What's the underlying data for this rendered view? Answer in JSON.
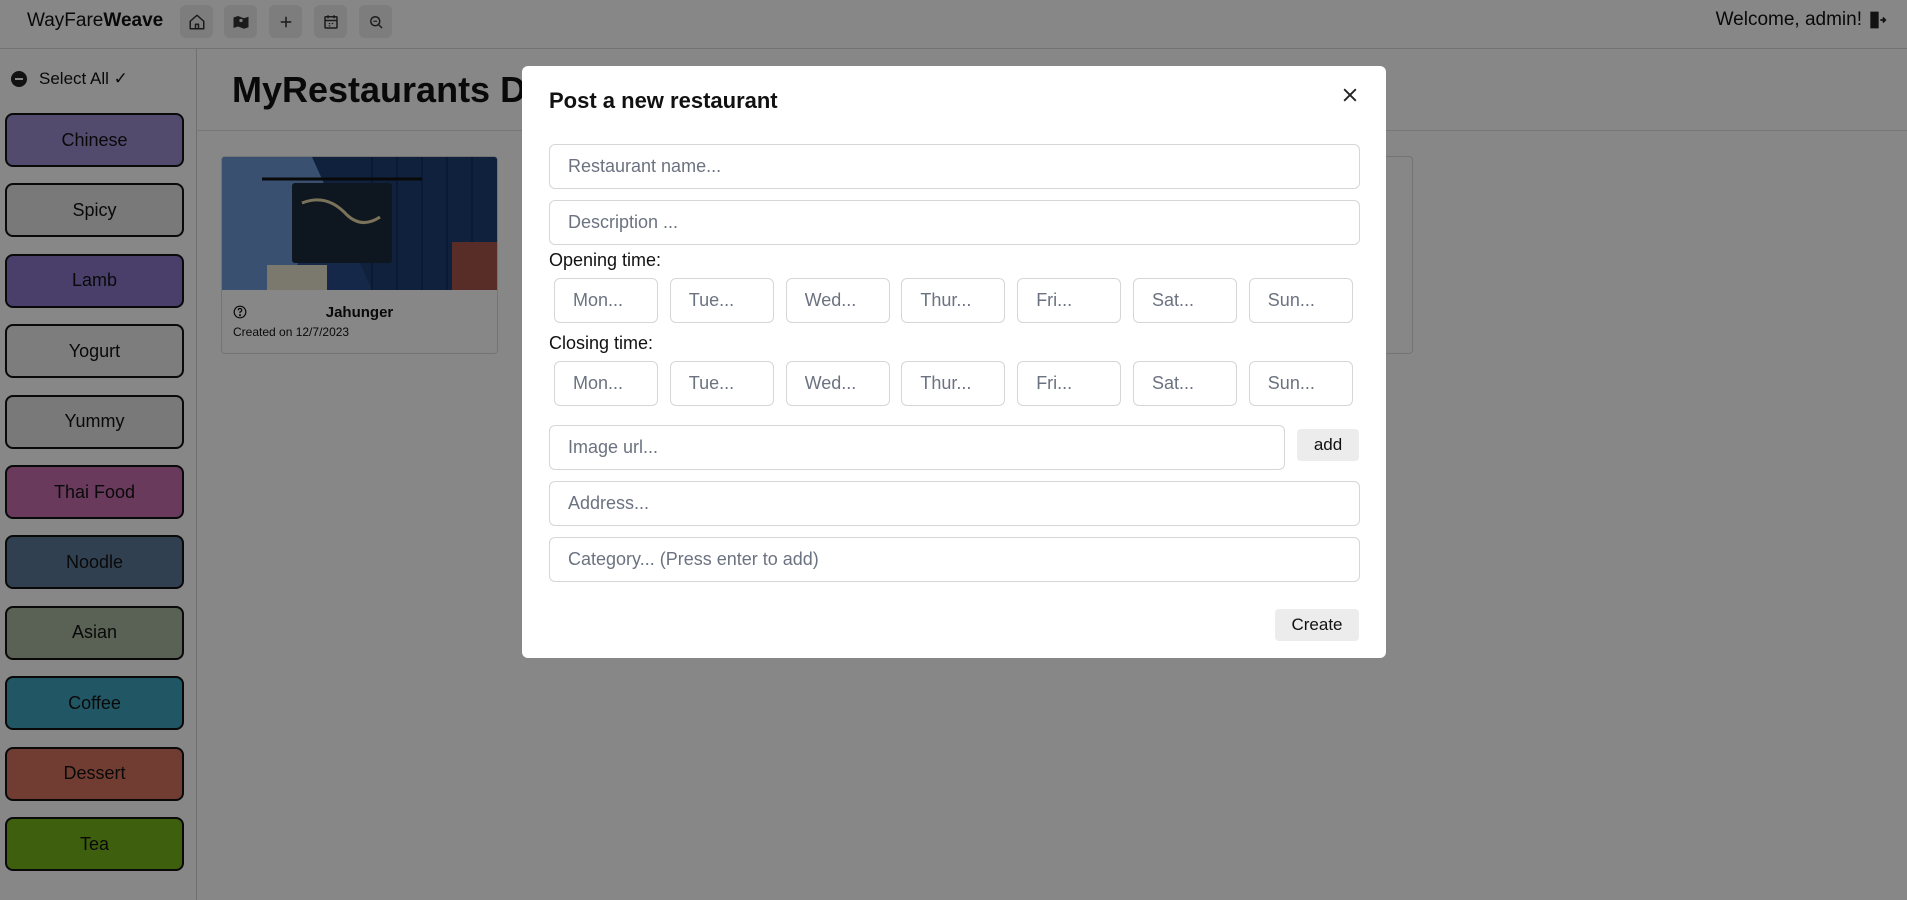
{
  "header": {
    "brand_plain": "WayFare",
    "brand_bold": "Weave",
    "nav": [
      {
        "icon": "home-icon"
      },
      {
        "icon": "map-icon"
      },
      {
        "icon": "plus-icon"
      },
      {
        "icon": "calendar-icon"
      },
      {
        "icon": "search-icon"
      }
    ],
    "welcome": "Welcome, admin!",
    "logout_icon": "logout-icon"
  },
  "sidebar": {
    "select_all": "Select All ✓",
    "categories": [
      {
        "label": "Chinese",
        "color": "#9b8fd0"
      },
      {
        "label": "Spicy",
        "color": "#e4e4e4"
      },
      {
        "label": "Lamb",
        "color": "#8a78c9"
      },
      {
        "label": "Yogurt",
        "color": "#ececec"
      },
      {
        "label": "Yummy",
        "color": "#e4e4e4"
      },
      {
        "label": "Thai Food",
        "color": "#c76fae"
      },
      {
        "label": "Noodle",
        "color": "#5d7a98"
      },
      {
        "label": "Asian",
        "color": "#a9b9a1"
      },
      {
        "label": "Coffee",
        "color": "#3fa2bd"
      },
      {
        "label": "Dessert",
        "color": "#d67460"
      },
      {
        "label": "Tea",
        "color": "#75b41b"
      }
    ]
  },
  "main": {
    "title": "MyRestaurants Dashboard",
    "card": {
      "name": "Jahunger",
      "created": "Created on 12/7/2023"
    }
  },
  "modal": {
    "title": "Post a new restaurant",
    "name_placeholder": "Restaurant name...",
    "description_placeholder": "Description ...",
    "opening_label": "Opening time:",
    "closing_label": "Closing time:",
    "days": [
      "Mon...",
      "Tue...",
      "Wed...",
      "Thur...",
      "Fri...",
      "Sat...",
      "Sun..."
    ],
    "image_placeholder": "Image url...",
    "add_label": "add",
    "address_placeholder": "Address...",
    "category_placeholder": "Category... (Press enter to add)",
    "create_label": "Create"
  }
}
